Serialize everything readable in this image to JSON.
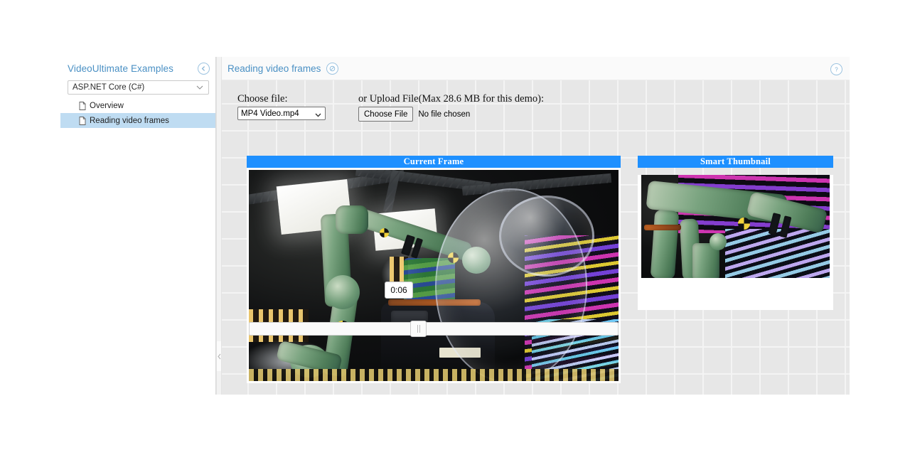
{
  "sidebar": {
    "title": "VideoUltimate Examples",
    "collapse_icon": "circle-chevron-left-icon",
    "framework_select": {
      "value": "ASP.NET Core (C#)",
      "options": [
        "ASP.NET Core (C#)"
      ]
    },
    "items": [
      {
        "label": "Overview",
        "icon": "document-icon",
        "active": false
      },
      {
        "label": "Reading video frames",
        "icon": "document-icon",
        "active": true
      }
    ]
  },
  "main": {
    "title": "Reading video frames",
    "title_icon": "circle-link-icon",
    "help_icon": "circle-question-icon",
    "form": {
      "choose_file_label": "Choose file:",
      "file_select_value": "MP4 Video.mp4",
      "file_select_options": [
        "MP4 Video.mp4"
      ],
      "upload_label": "or Upload File(Max 28.6 MB for this demo):",
      "choose_file_button": "Choose File",
      "no_file_text": "No file chosen"
    },
    "current_frame": {
      "title": "Current Frame",
      "image_alt": "green industrial robot arm in a studio with stage lighting and a large soap bubble"
    },
    "smart_thumbnail": {
      "title": "Smart Thumbnail",
      "image_alt": "close-up of the green robot arm against magenta and blue neon tubes"
    },
    "timeline": {
      "tooltip_value": "0:06",
      "handle_icon": "slider-handle-icon"
    }
  },
  "colors": {
    "accent_blue": "#1e90ff",
    "link_blue": "#4a90c4",
    "active_nav": "#bfdcf2",
    "canvas_grid": "#e7e7e7"
  }
}
